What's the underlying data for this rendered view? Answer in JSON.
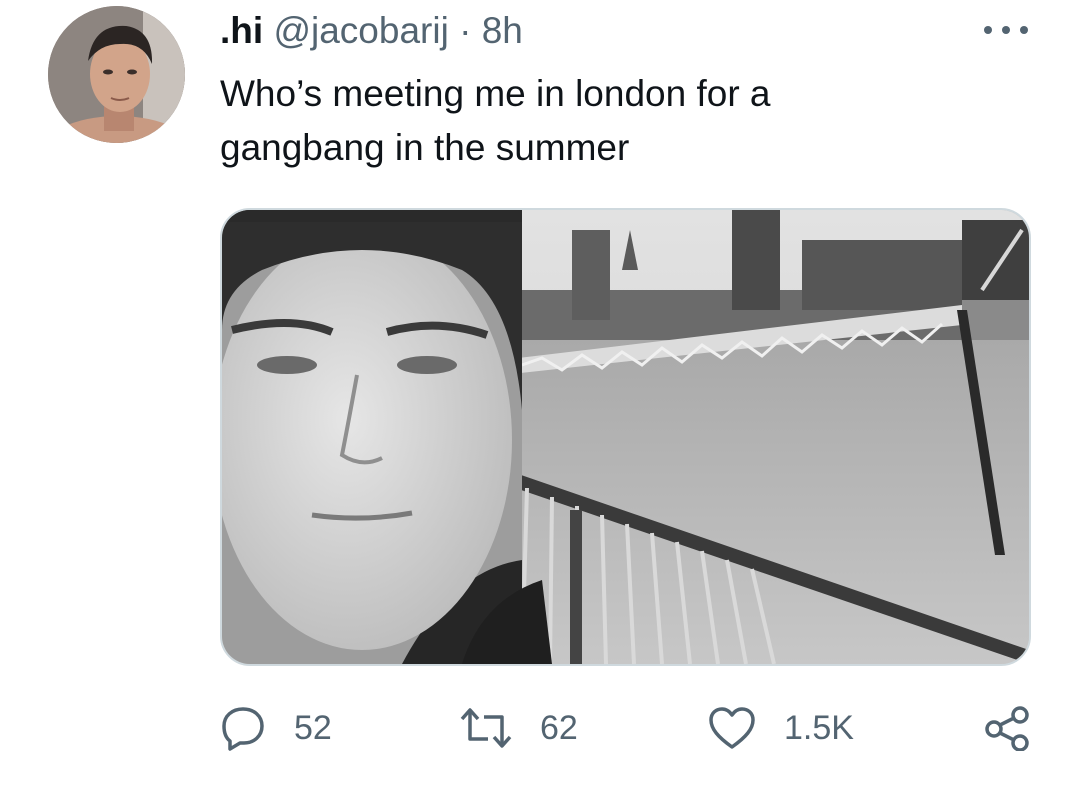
{
  "tweet": {
    "display_name": ".hi",
    "handle": "@jacobarij",
    "separator": "·",
    "time": "8h",
    "text_line1": "Who’s meeting me in london for a",
    "text_line2": "gangbang in the summer"
  },
  "actions": {
    "replies": "52",
    "retweets": "62",
    "likes": "1.5K"
  },
  "icons": {
    "more": "more-options-icon",
    "reply": "reply-icon",
    "retweet": "retweet-icon",
    "like": "heart-icon",
    "share": "share-icon"
  },
  "colors": {
    "text": "#0f1419",
    "secondary": "#536471",
    "media_border": "#cfd9de"
  }
}
